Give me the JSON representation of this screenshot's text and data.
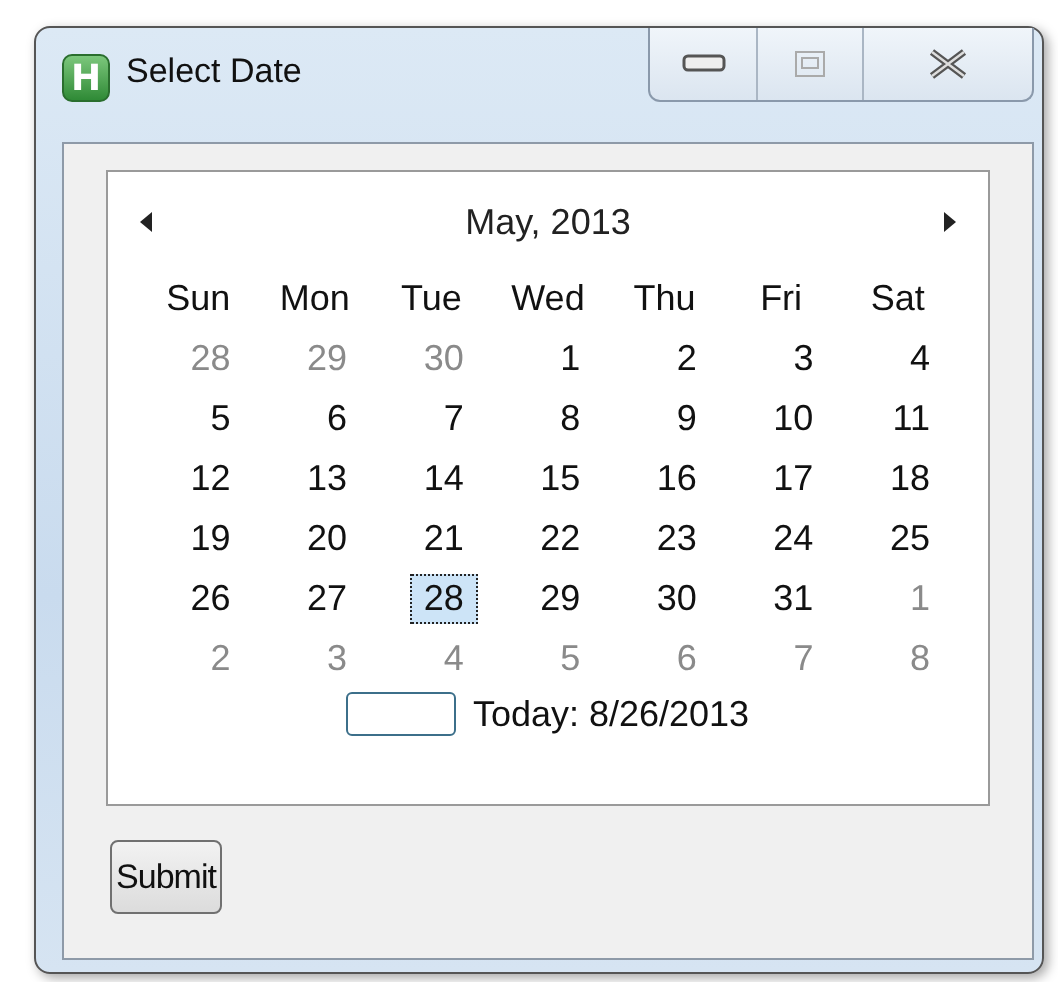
{
  "window": {
    "title": "Select Date",
    "app_icon_letter": "H"
  },
  "calendar": {
    "month_label": "May, 2013",
    "weekdays": [
      "Sun",
      "Mon",
      "Tue",
      "Wed",
      "Thu",
      "Fri",
      "Sat"
    ],
    "weeks": [
      [
        {
          "day": "28",
          "other_month": true,
          "selected": false
        },
        {
          "day": "29",
          "other_month": true,
          "selected": false
        },
        {
          "day": "30",
          "other_month": true,
          "selected": false
        },
        {
          "day": "1",
          "other_month": false,
          "selected": false
        },
        {
          "day": "2",
          "other_month": false,
          "selected": false
        },
        {
          "day": "3",
          "other_month": false,
          "selected": false
        },
        {
          "day": "4",
          "other_month": false,
          "selected": false
        }
      ],
      [
        {
          "day": "5",
          "other_month": false,
          "selected": false
        },
        {
          "day": "6",
          "other_month": false,
          "selected": false
        },
        {
          "day": "7",
          "other_month": false,
          "selected": false
        },
        {
          "day": "8",
          "other_month": false,
          "selected": false
        },
        {
          "day": "9",
          "other_month": false,
          "selected": false
        },
        {
          "day": "10",
          "other_month": false,
          "selected": false
        },
        {
          "day": "11",
          "other_month": false,
          "selected": false
        }
      ],
      [
        {
          "day": "12",
          "other_month": false,
          "selected": false
        },
        {
          "day": "13",
          "other_month": false,
          "selected": false
        },
        {
          "day": "14",
          "other_month": false,
          "selected": false
        },
        {
          "day": "15",
          "other_month": false,
          "selected": false
        },
        {
          "day": "16",
          "other_month": false,
          "selected": false
        },
        {
          "day": "17",
          "other_month": false,
          "selected": false
        },
        {
          "day": "18",
          "other_month": false,
          "selected": false
        }
      ],
      [
        {
          "day": "19",
          "other_month": false,
          "selected": false
        },
        {
          "day": "20",
          "other_month": false,
          "selected": false
        },
        {
          "day": "21",
          "other_month": false,
          "selected": false
        },
        {
          "day": "22",
          "other_month": false,
          "selected": false
        },
        {
          "day": "23",
          "other_month": false,
          "selected": false
        },
        {
          "day": "24",
          "other_month": false,
          "selected": false
        },
        {
          "day": "25",
          "other_month": false,
          "selected": false
        }
      ],
      [
        {
          "day": "26",
          "other_month": false,
          "selected": false
        },
        {
          "day": "27",
          "other_month": false,
          "selected": false
        },
        {
          "day": "28",
          "other_month": false,
          "selected": true
        },
        {
          "day": "29",
          "other_month": false,
          "selected": false
        },
        {
          "day": "30",
          "other_month": false,
          "selected": false
        },
        {
          "day": "31",
          "other_month": false,
          "selected": false
        },
        {
          "day": "1",
          "other_month": true,
          "selected": false
        }
      ],
      [
        {
          "day": "2",
          "other_month": true,
          "selected": false
        },
        {
          "day": "3",
          "other_month": true,
          "selected": false
        },
        {
          "day": "4",
          "other_month": true,
          "selected": false
        },
        {
          "day": "5",
          "other_month": true,
          "selected": false
        },
        {
          "day": "6",
          "other_month": true,
          "selected": false
        },
        {
          "day": "7",
          "other_month": true,
          "selected": false
        },
        {
          "day": "8",
          "other_month": true,
          "selected": false
        }
      ]
    ],
    "today_label": "Today: 8/26/2013"
  },
  "buttons": [
    {
      "label": "Submit"
    }
  ]
}
